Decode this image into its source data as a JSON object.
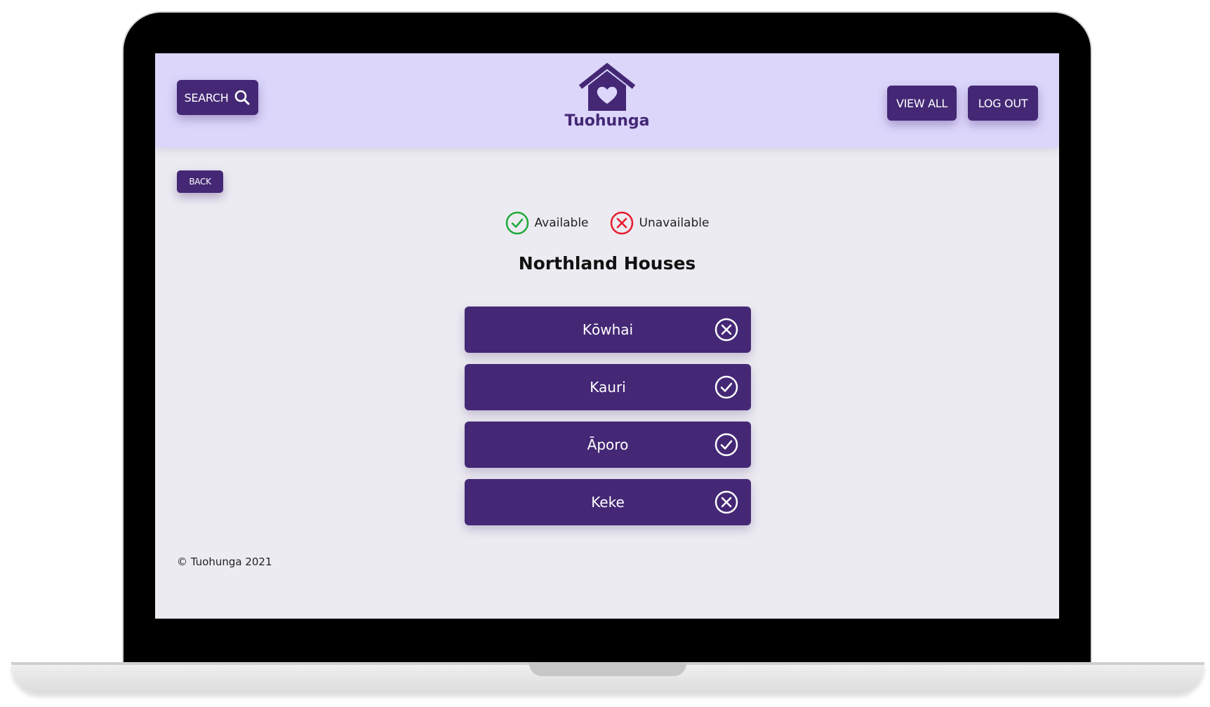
{
  "header": {
    "search_label": "SEARCH",
    "brand": "Tuohunga",
    "view_all_label": "VIEW ALL",
    "logout_label": "LOG OUT"
  },
  "nav": {
    "back_label": "BACK"
  },
  "legend": {
    "available_label": "Available",
    "unavailable_label": "Unavailable"
  },
  "page_title": "Northland Houses",
  "houses": [
    {
      "name": "Kōwhai",
      "status": "unavailable",
      "icon": "x-circle-icon"
    },
    {
      "name": "Kauri",
      "status": "available",
      "icon": "check-circle-icon"
    },
    {
      "name": "Āporo",
      "status": "available",
      "icon": "check-circle-icon"
    },
    {
      "name": "Keke",
      "status": "unavailable",
      "icon": "x-circle-icon"
    }
  ],
  "footer": {
    "copyright": "© Tuohunga 2021"
  },
  "colors": {
    "primary": "#442875",
    "header_bg": "#dcd6fb",
    "page_bg": "#ecebf1",
    "available": "#1faa3a",
    "unavailable": "#e8192c"
  }
}
